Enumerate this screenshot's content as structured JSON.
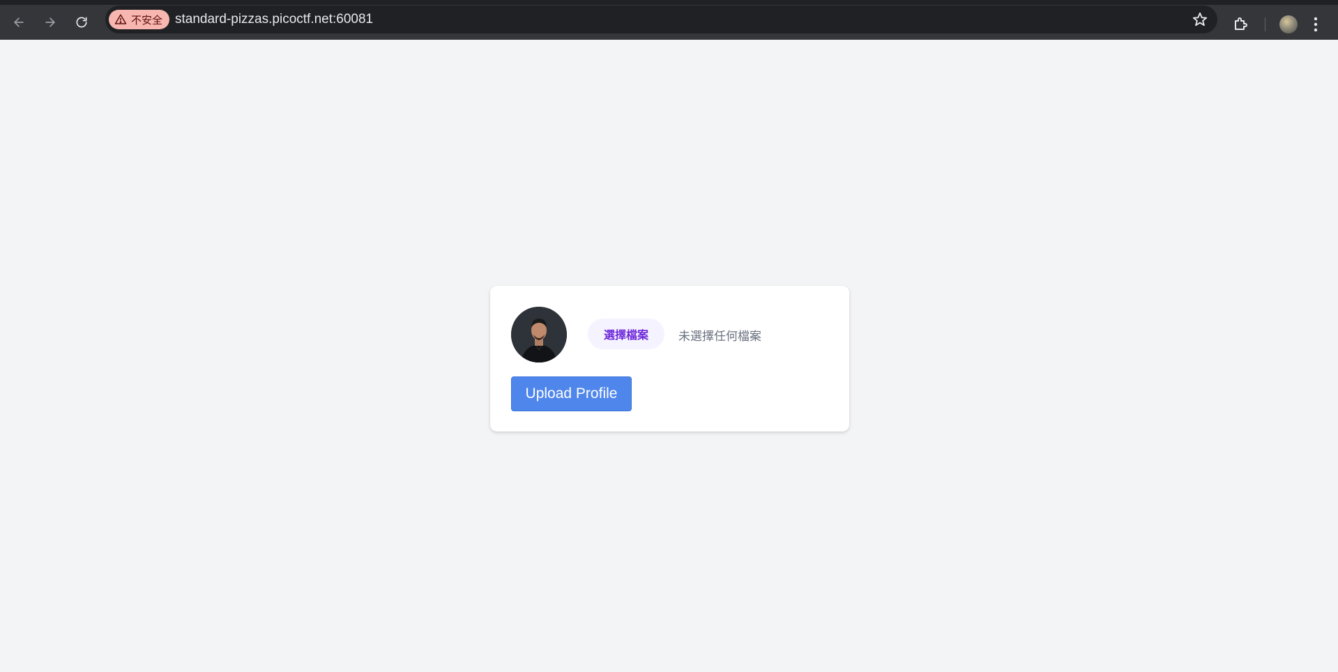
{
  "browser": {
    "security_label": "不安全",
    "url": "standard-pizzas.picoctf.net:60081",
    "icons": {
      "back": "back-arrow-icon",
      "forward": "forward-arrow-icon",
      "reload": "reload-icon",
      "warning": "warning-triangle-icon",
      "bookmark": "star-icon",
      "extensions": "puzzle-icon",
      "profile": "avatar",
      "menu": "kebab-menu-icon"
    }
  },
  "upload_form": {
    "choose_file_label": "選擇檔案",
    "no_file_text": "未選擇任何檔案",
    "upload_button_label": "Upload Profile"
  },
  "colors": {
    "page_bg": "#f3f4f6",
    "file_button_text": "#6d28d9",
    "file_button_bg": "#f5f3ff",
    "upload_button_bg": "#4f86ec",
    "security_chip_bg": "#f8b6b0"
  }
}
